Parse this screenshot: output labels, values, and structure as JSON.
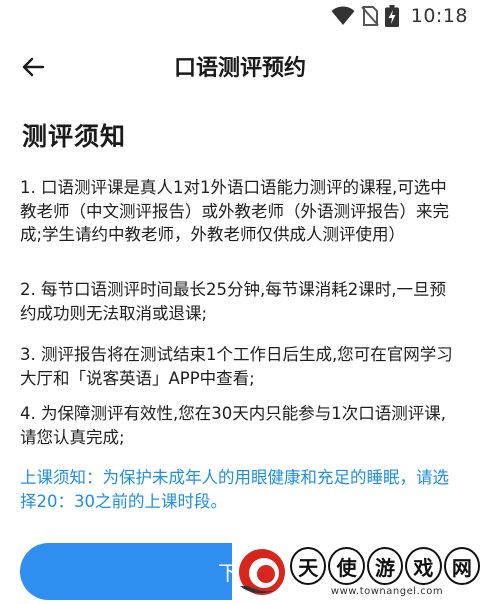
{
  "status_bar": {
    "time": "10:18",
    "icons": [
      "wifi-icon",
      "no-sim-icon",
      "battery-charging-icon"
    ]
  },
  "app_bar": {
    "back_icon": "arrow-left-icon",
    "title": "口语测评预约"
  },
  "content": {
    "section_title": "测评须知",
    "rules": [
      "1.  口语测评课是真人1对1外语口语能力测评的课程,可选中教老师（中文测评报告）或外教老师（外语测评报告）来完成;学生请约中教老师，外教老师仅供成人测评使用）",
      " 2.  每节口语测评时间最长25分钟,每节课消耗2课时,一旦预约成功则无法取消或退课;",
      " 3.  测评报告将在测试结束1个工作日后生成,您可在官网学习大厅和「说客英语」APP中查看;",
      " 4.  为保障测评有效性,您在30天内只能参与1次口语测评课,请您认真完成;"
    ],
    "notice": "上课须知：为保护未成年人的用眼健康和充足的睡眠，请选择20：30之前的上课时段。"
  },
  "footer": {
    "button_label": "下"
  },
  "watermark": {
    "chars": [
      "天",
      "使",
      "游",
      "戏",
      "网"
    ],
    "url": "www.townangel.com"
  },
  "colors": {
    "accent": "#2f8ff0",
    "notice_text": "#1e8fe6"
  }
}
